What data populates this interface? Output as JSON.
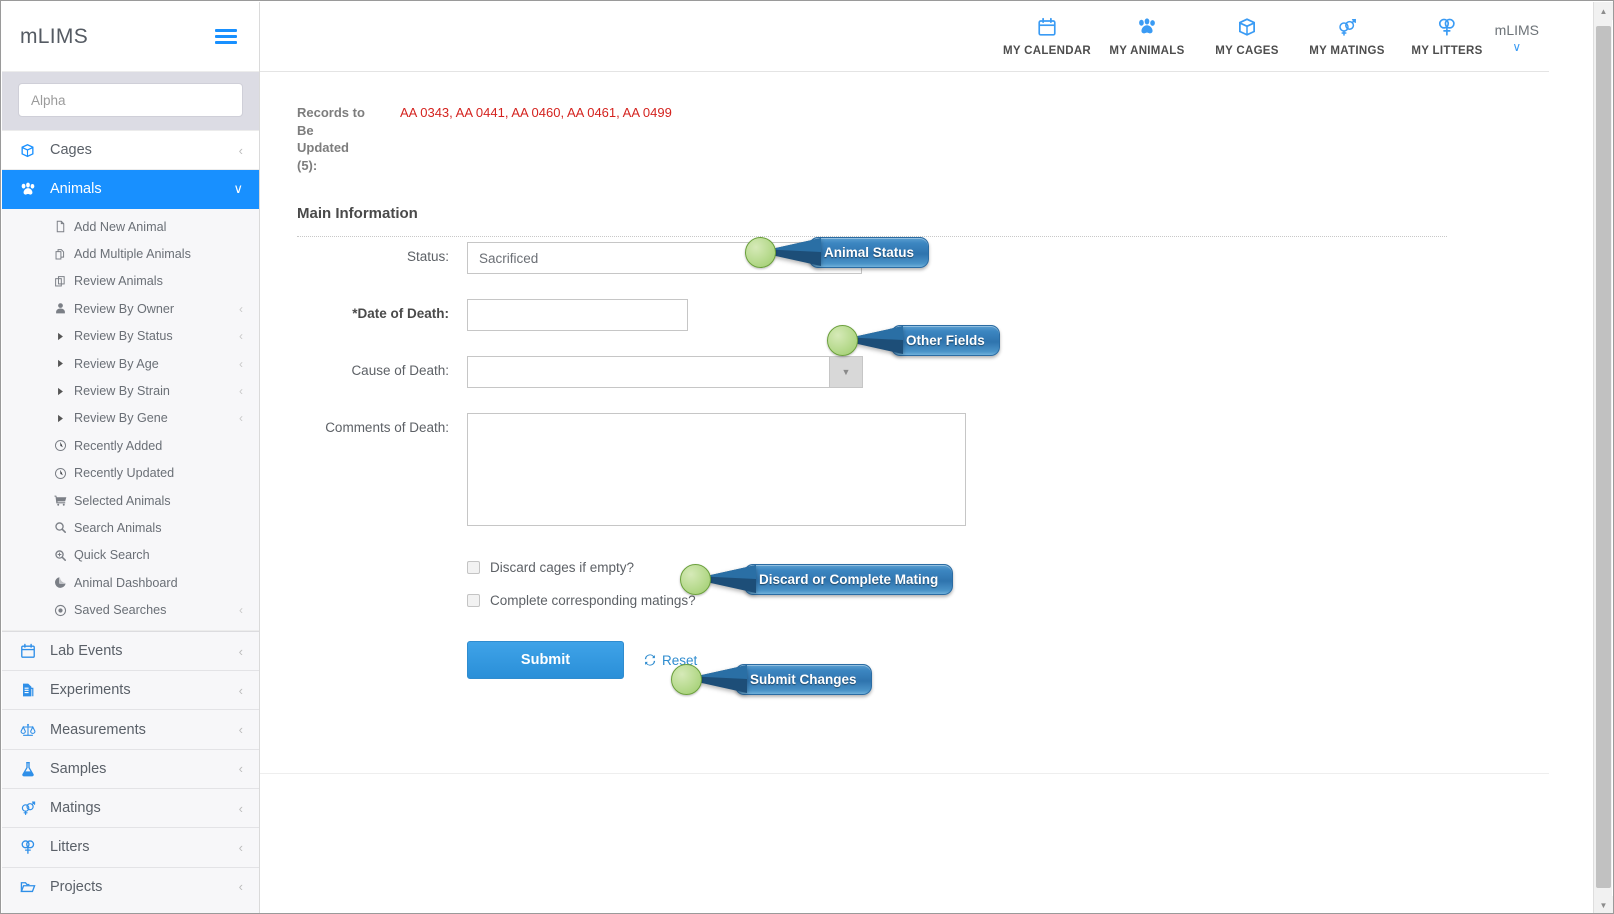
{
  "sidebar": {
    "brand": "mLIMS",
    "hamburger_icon": "hamburger-menu-icon",
    "search": {
      "value": "",
      "placeholder": "Alpha"
    },
    "nav_top": [
      {
        "label": "Cages",
        "icon": "cube-icon",
        "caret": "‹",
        "active": false
      },
      {
        "label": "Animals",
        "icon": "paw-icon",
        "caret": "∨",
        "active": true
      }
    ],
    "sub_items": [
      {
        "label": "Add New Animal",
        "icon": "file-icon",
        "caret": "",
        "arrow": false
      },
      {
        "label": "Add Multiple Animals",
        "icon": "copy-add-icon",
        "caret": "",
        "arrow": false
      },
      {
        "label": "Review Animals",
        "icon": "copy-icon",
        "caret": "",
        "arrow": false
      },
      {
        "label": "Review By Owner",
        "icon": "user-icon",
        "caret": "‹",
        "arrow": false
      },
      {
        "label": "Review By Status",
        "icon": "triangle-right-icon",
        "caret": "‹",
        "arrow": true
      },
      {
        "label": "Review By Age",
        "icon": "triangle-right-icon",
        "caret": "‹",
        "arrow": true
      },
      {
        "label": "Review By Strain",
        "icon": "triangle-right-icon",
        "caret": "‹",
        "arrow": true
      },
      {
        "label": "Review By Gene",
        "icon": "triangle-right-icon",
        "caret": "‹",
        "arrow": true
      },
      {
        "label": "Recently Added",
        "icon": "clock-icon",
        "caret": "",
        "arrow": false
      },
      {
        "label": "Recently Updated",
        "icon": "clock-icon",
        "caret": "",
        "arrow": false
      },
      {
        "label": "Selected Animals",
        "icon": "cart-icon",
        "caret": "",
        "arrow": false
      },
      {
        "label": "Search Animals",
        "icon": "search-icon",
        "caret": "",
        "arrow": false
      },
      {
        "label": "Quick Search",
        "icon": "search-plus-icon",
        "caret": "",
        "arrow": false
      },
      {
        "label": "Animal Dashboard",
        "icon": "pie-chart-icon",
        "caret": "",
        "arrow": false
      },
      {
        "label": "Saved Searches",
        "icon": "target-icon",
        "caret": "‹",
        "arrow": false
      }
    ],
    "nav_lower": [
      {
        "label": "Lab Events",
        "icon": "calendar-icon",
        "caret": "‹"
      },
      {
        "label": "Experiments",
        "icon": "experiment-icon",
        "caret": "‹"
      },
      {
        "label": "Measurements",
        "icon": "scales-icon",
        "caret": "‹"
      },
      {
        "label": "Samples",
        "icon": "flask-icon",
        "caret": "‹"
      },
      {
        "label": "Matings",
        "icon": "mating-icon",
        "caret": "‹"
      },
      {
        "label": "Litters",
        "icon": "litter-icon",
        "caret": "‹"
      },
      {
        "label": "Projects",
        "icon": "folder-icon",
        "caret": "‹"
      }
    ]
  },
  "header": {
    "nav": [
      {
        "label": "MY CALENDAR",
        "icon": "calendar-icon"
      },
      {
        "label": "MY ANIMALS",
        "icon": "paw-icon"
      },
      {
        "label": "MY CAGES",
        "icon": "cube-icon"
      },
      {
        "label": "MY MATINGS",
        "icon": "mating-icon"
      },
      {
        "label": "MY LITTERS",
        "icon": "litter-icon"
      }
    ],
    "user": {
      "name": "mLIMS",
      "caret": "∨"
    }
  },
  "main": {
    "records": {
      "label": "Records to Be Updated (5):",
      "value": "AA 0343, AA 0441, AA 0460, AA 0461, AA 0499",
      "count": 5
    },
    "section_title": "Main Information",
    "fields": {
      "status": {
        "label": "Status:",
        "value": "Sacrificed"
      },
      "date_of_death": {
        "label": "*Date of Death:",
        "value": "",
        "placeholder": ""
      },
      "cause_of_death": {
        "label": "Cause of Death:",
        "value": "",
        "selected": ""
      },
      "comments_of_death": {
        "label": "Comments of Death:",
        "value": "",
        "placeholder": ""
      }
    },
    "checkboxes": [
      {
        "label": "Discard cages if empty?",
        "checked": false
      },
      {
        "label": "Complete corresponding matings?",
        "checked": false
      }
    ],
    "actions": {
      "submit_label": "Submit",
      "reset_label": "Reset",
      "reset_icon": "refresh-icon"
    }
  },
  "callouts": [
    {
      "text": "Animal Status"
    },
    {
      "text": "Other Fields"
    },
    {
      "text": "Discard or Complete Mating"
    },
    {
      "text": "Submit Changes"
    }
  ],
  "scrollbar": {
    "up_icon": "triangle-up-icon",
    "down_icon": "triangle-down-icon"
  },
  "colors": {
    "accent": "#1890ff",
    "record_text": "#d4231f",
    "callout_bubble": "#2f74ae",
    "callout_dot": "#b7da8e",
    "submit_button": "#2a8fd8"
  }
}
